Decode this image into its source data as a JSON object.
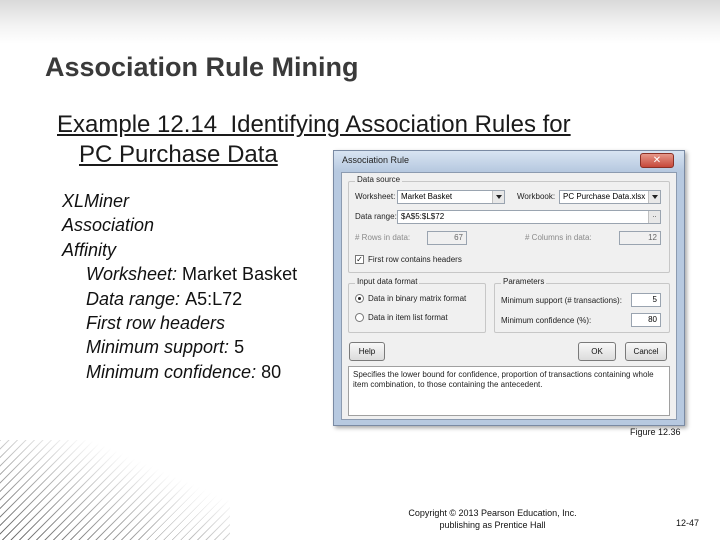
{
  "slide": {
    "title": "Association Rule Mining",
    "subtitle_line1": "Example 12.14  Identifying Association Rules for",
    "subtitle_line2": "PC Purchase Data",
    "steps": [
      "XLMiner",
      "Association",
      "Affinity"
    ],
    "settings": [
      {
        "label": "Worksheet:",
        "value": "Market Basket"
      },
      {
        "label": "Data range:",
        "value": "A5:L72"
      },
      {
        "label": "First row headers",
        "value": ""
      },
      {
        "label": "Minimum support:",
        "value": "5"
      },
      {
        "label": "Minimum confidence:",
        "value": "80"
      }
    ],
    "figure_caption": "Figure 12.36",
    "copyright_line1": "Copyright © 2013 Pearson Education, Inc.",
    "copyright_line2": "publishing as Prentice Hall",
    "page_number": "12-47"
  },
  "dialog": {
    "title": "Association Rule",
    "close_glyph": "✕",
    "data_source": {
      "legend": "Data source",
      "worksheet_label": "Worksheet:",
      "worksheet_value": "Market Basket",
      "workbook_label": "Workbook:",
      "workbook_value": "PC Purchase Data.xlsx",
      "data_range_label": "Data range:",
      "data_range_value": "$A$5:$L$72",
      "range_button": "..",
      "rows_label": "# Rows in data:",
      "rows_value": "67",
      "columns_label": "# Columns in data:",
      "columns_value": "12",
      "first_row_headers_label": "First row contains headers",
      "first_row_headers_checked": true,
      "check_glyph": "✓"
    },
    "input_format": {
      "legend": "Input data format",
      "option_binary": "Data in binary matrix format",
      "option_item_list": "Data in item list format",
      "selected": "binary"
    },
    "parameters": {
      "legend": "Parameters",
      "min_support_label": "Minimum support (# transactions):",
      "min_support_value": "5",
      "min_confidence_label": "Minimum confidence (%):",
      "min_confidence_value": "80"
    },
    "buttons": {
      "help": "Help",
      "ok": "OK",
      "cancel": "Cancel"
    },
    "help_text": "Specifies the lower bound for confidence, proportion of transactions containing whole item combination, to those containing the antecedent."
  },
  "colors": {
    "title": "#3a3a3a",
    "dialog_frame": "#b7c9e0",
    "close_button": "#c6483a"
  }
}
